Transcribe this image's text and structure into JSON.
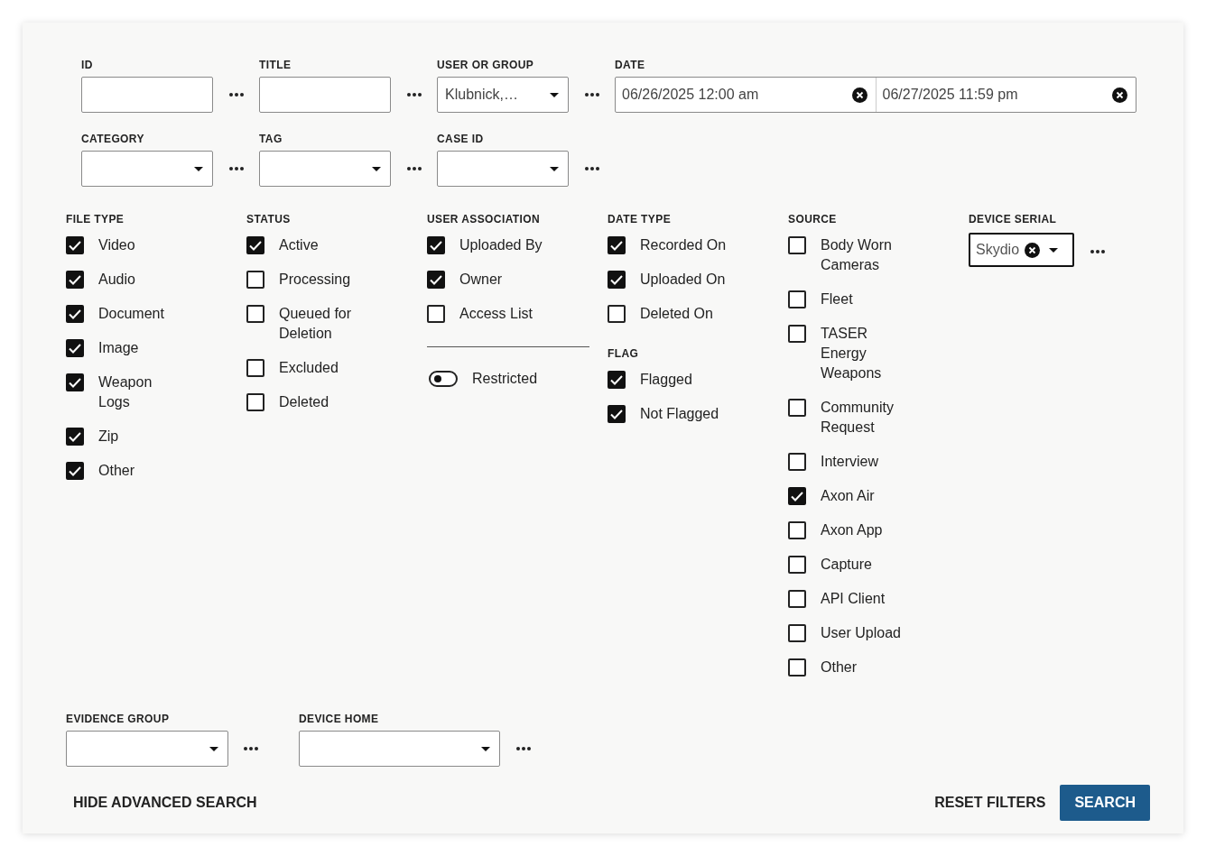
{
  "top_rows": [
    {
      "fields": [
        {
          "kind": "text",
          "label": "ID"
        },
        {
          "kind": "text",
          "label": "TITLE"
        },
        {
          "kind": "select",
          "label": "USER OR GROUP",
          "value": "Klubnick,…"
        },
        {
          "kind": "daterange",
          "label": "DATE",
          "start": "06/26/2025 12:00 am",
          "end": "06/27/2025 11:59 pm"
        }
      ]
    },
    {
      "fields": [
        {
          "kind": "select",
          "label": "CATEGORY"
        },
        {
          "kind": "select",
          "label": "TAG"
        },
        {
          "kind": "select",
          "label": "CASE ID"
        }
      ]
    }
  ],
  "columns": [
    {
      "sections": [
        {
          "kind": "checkboxes",
          "title": "FILE TYPE",
          "items": [
            {
              "label": "Video",
              "checked": true
            },
            {
              "label": "Audio",
              "checked": true
            },
            {
              "label": "Document",
              "checked": true
            },
            {
              "label": "Image",
              "checked": true
            },
            {
              "label": "Weapon Logs",
              "checked": true
            },
            {
              "label": "Zip",
              "checked": true
            },
            {
              "label": "Other",
              "checked": true
            }
          ]
        }
      ]
    },
    {
      "sections": [
        {
          "kind": "checkboxes",
          "title": "STATUS",
          "items": [
            {
              "label": "Active",
              "checked": true
            },
            {
              "label": "Processing",
              "checked": false
            },
            {
              "label": "Queued for Deletion",
              "checked": false
            },
            {
              "label": "Excluded",
              "checked": false
            },
            {
              "label": "Deleted",
              "checked": false
            }
          ]
        }
      ]
    },
    {
      "sections": [
        {
          "kind": "checkboxes",
          "title": "USER ASSOCIATION",
          "items": [
            {
              "label": "Uploaded By",
              "checked": true
            },
            {
              "label": "Owner",
              "checked": true
            },
            {
              "label": "Access List",
              "checked": false
            }
          ]
        },
        {
          "kind": "toggle",
          "label": "Restricted",
          "on": false
        }
      ]
    },
    {
      "sections": [
        {
          "kind": "checkboxes",
          "title": "DATE TYPE",
          "items": [
            {
              "label": "Recorded On",
              "checked": true
            },
            {
              "label": "Uploaded On",
              "checked": true
            },
            {
              "label": "Deleted On",
              "checked": false
            }
          ]
        },
        {
          "kind": "checkboxes",
          "title": "FLAG",
          "items": [
            {
              "label": "Flagged",
              "checked": true
            },
            {
              "label": "Not Flagged",
              "checked": true
            }
          ]
        }
      ]
    },
    {
      "sections": [
        {
          "kind": "checkboxes",
          "title": "SOURCE",
          "items": [
            {
              "label": "Body Worn Cameras",
              "checked": false
            },
            {
              "label": "Fleet",
              "checked": false
            },
            {
              "label": "TASER Energy Weapons",
              "checked": false
            },
            {
              "label": "Community Request",
              "checked": false
            },
            {
              "label": "Interview",
              "checked": false
            },
            {
              "label": "Axon Air",
              "checked": true
            },
            {
              "label": "Axon App",
              "checked": false
            },
            {
              "label": "Capture",
              "checked": false
            },
            {
              "label": "API Client",
              "checked": false
            },
            {
              "label": "User Upload",
              "checked": false
            },
            {
              "label": "Other",
              "checked": false
            }
          ]
        }
      ]
    },
    {
      "sections": [
        {
          "kind": "chipselect",
          "title": "DEVICE SERIAL",
          "value": "Skydio"
        }
      ]
    }
  ],
  "bottom_fields": [
    {
      "kind": "select",
      "label": "EVIDENCE GROUP"
    },
    {
      "kind": "select",
      "label": "DEVICE HOME"
    }
  ],
  "footer": {
    "toggle_link": "HIDE ADVANCED SEARCH",
    "reset": "RESET FILTERS",
    "search": "SEARCH"
  }
}
